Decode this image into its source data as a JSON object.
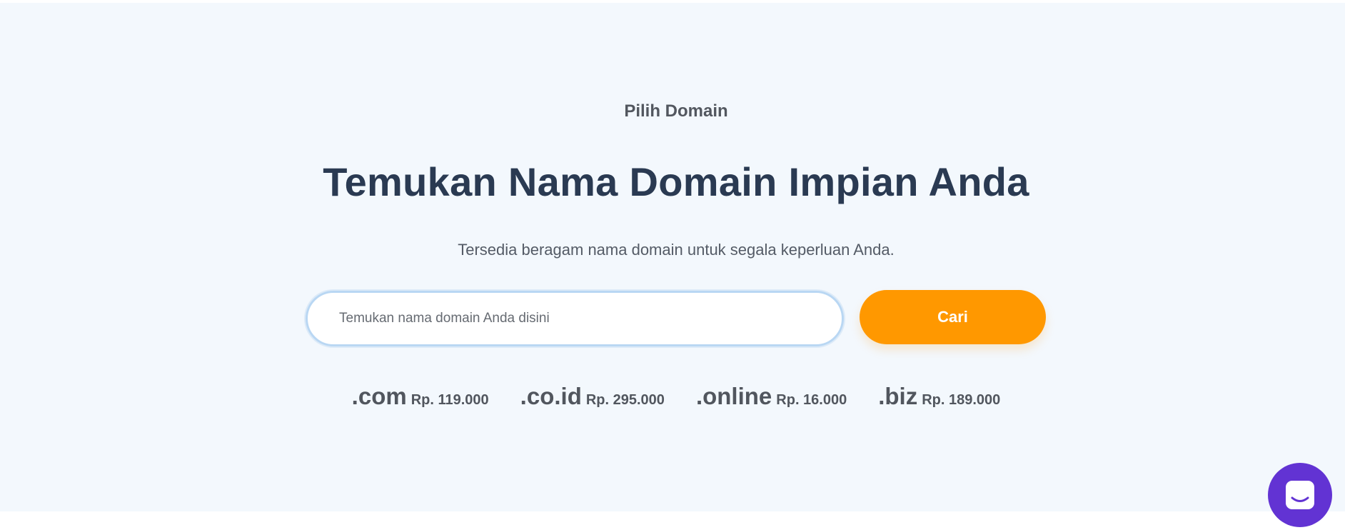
{
  "hero": {
    "eyebrow": "Pilih Domain",
    "title": "Temukan Nama Domain Impian Anda",
    "subtitle": "Tersedia beragam nama domain untuk segala keperluan Anda."
  },
  "search": {
    "placeholder": "Temukan nama domain Anda disini",
    "value": "",
    "button_label": "Cari"
  },
  "tlds": [
    {
      "ext": ".com",
      "price": "Rp. 119.000"
    },
    {
      "ext": ".co.id",
      "price": "Rp. 295.000"
    },
    {
      "ext": ".online",
      "price": "Rp. 16.000"
    },
    {
      "ext": ".biz",
      "price": "Rp. 189.000"
    }
  ],
  "chat": {
    "icon": "chat-icon"
  },
  "colors": {
    "hero_background": "#f3f8fd",
    "accent": "#ff9800",
    "heading": "#2a3a52",
    "chat_button": "#6233d3"
  }
}
